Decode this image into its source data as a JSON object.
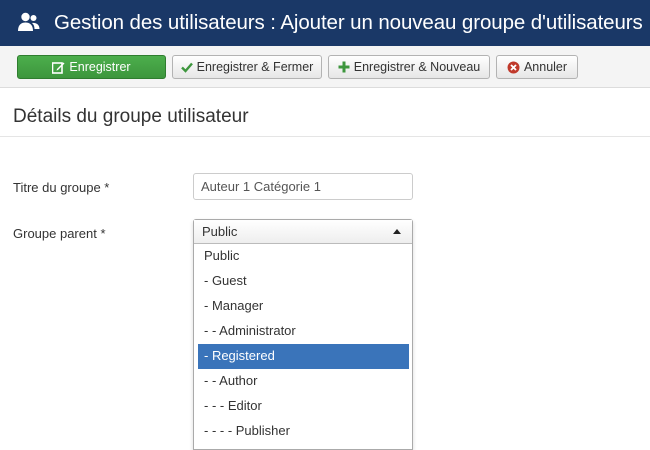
{
  "header": {
    "title": "Gestion des utilisateurs : Ajouter un nouveau groupe d'utilisateurs",
    "icon": "users-icon",
    "background": "#1a3867"
  },
  "toolbar": {
    "save_label": "Enregistrer",
    "save_close_label": "Enregistrer & Fermer",
    "save_new_label": "Enregistrer & Nouveau",
    "cancel_label": "Annuler",
    "save_color": "#46a546"
  },
  "form": {
    "section_title": "Détails du groupe utilisateur",
    "title_label": "Titre du groupe *",
    "title_value": "Auteur 1 Catégorie 1",
    "parent_label": "Groupe parent *",
    "parent_value": "Public",
    "parent_options": [
      "Public",
      "- Guest",
      "- Manager",
      "- - Administrator",
      "- Registered",
      "- - Author",
      "- - - Editor",
      "- - - - Publisher"
    ],
    "highlighted_option": "- Registered",
    "highlight_color": "#3a74ba"
  }
}
